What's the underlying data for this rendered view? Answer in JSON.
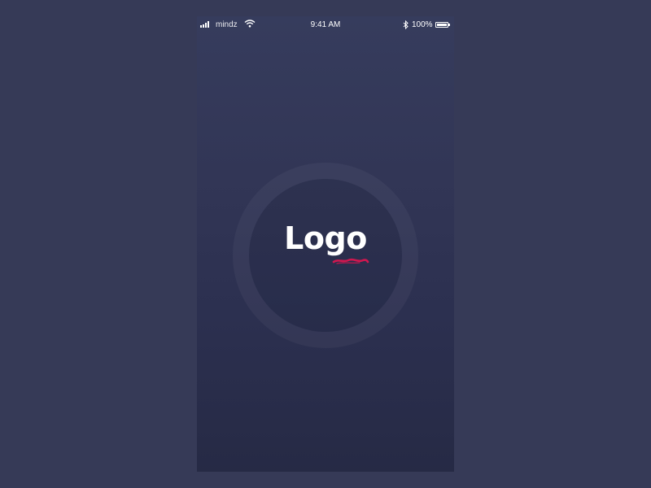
{
  "status_bar": {
    "carrier": "mindz",
    "time": "9:41 AM",
    "battery_percent": "100%",
    "signal_bars": 4,
    "battery_level": 1.0
  },
  "splash": {
    "logo_text": "Logo"
  },
  "colors": {
    "background": "#363a57",
    "screen_top": "#363c5d",
    "screen_bottom": "#262a45",
    "logo_text": "#ffffff",
    "accent_swoosh": "#d0174f"
  }
}
